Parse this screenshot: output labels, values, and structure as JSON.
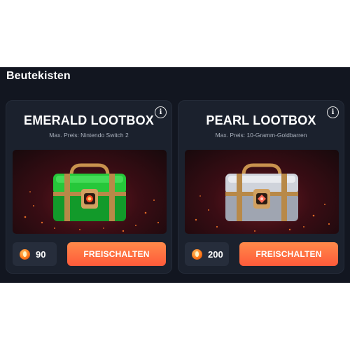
{
  "section": {
    "title": "Beutekisten"
  },
  "lootboxes": [
    {
      "name": "EMERALD LOOTBOX",
      "subtitle": "Max. Preis: Nintendo Switch 2",
      "price": "90",
      "button_label": "FREISCHALTEN",
      "info_label": "i",
      "chest_color": "#22c23a"
    },
    {
      "name": "PEARL LOOTBOX",
      "subtitle": "Max. Preis: 10-Gramm-Goldbarren",
      "price": "200",
      "button_label": "FREISCHALTEN",
      "info_label": "i",
      "chest_color": "#c9ccd4"
    }
  ],
  "colors": {
    "background": "#121620",
    "card": "#1b212d",
    "button": "#ff6a3d",
    "price_box": "#262d3b"
  },
  "icons": [
    "info-icon",
    "coin-icon",
    "chest-image"
  ]
}
